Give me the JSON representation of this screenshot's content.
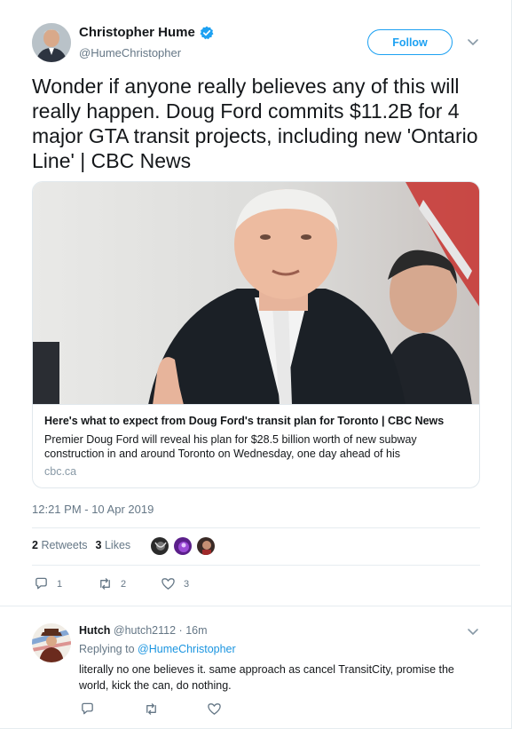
{
  "tweet": {
    "author_name": "Christopher Hume",
    "author_handle": "@HumeChristopher",
    "follow_label": "Follow",
    "text": "Wonder if anyone really believes any of this will really happen. Doug Ford commits $11.2B for 4 major GTA transit projects, including new 'Ontario Line' | CBC News",
    "timestamp": "12:21 PM - 10 Apr 2019",
    "retweets_count": "2",
    "retweets_label": "Retweets",
    "likes_count": "3",
    "likes_label": "Likes",
    "actions": {
      "reply_count": "1",
      "retweet_count": "2",
      "like_count": "3"
    }
  },
  "card": {
    "title": "Here's what to expect from Doug Ford's transit plan for Toronto | CBC News",
    "description": "Premier Doug Ford will reveal his plan for $28.5 billion worth of new subway construction in and around Toronto on Wednesday, one day ahead of his",
    "domain": "cbc.ca"
  },
  "reply": {
    "author_name": "Hutch",
    "author_handle": "@hutch2112",
    "separator": "·",
    "time": "16m",
    "replying_prefix": "Replying to",
    "replying_to": "@HumeChristopher",
    "text": "literally no one believes it.  same approach as cancel TransitCity, promise the world, kick the can, do nothing."
  },
  "colors": {
    "accent": "#1da1f2",
    "link": "#1b95e0",
    "secondary_text": "#657786",
    "border": "#e6ecf0"
  },
  "icons": [
    "verified-badge-icon",
    "chevron-down-icon",
    "reply-icon",
    "retweet-icon",
    "like-icon"
  ]
}
